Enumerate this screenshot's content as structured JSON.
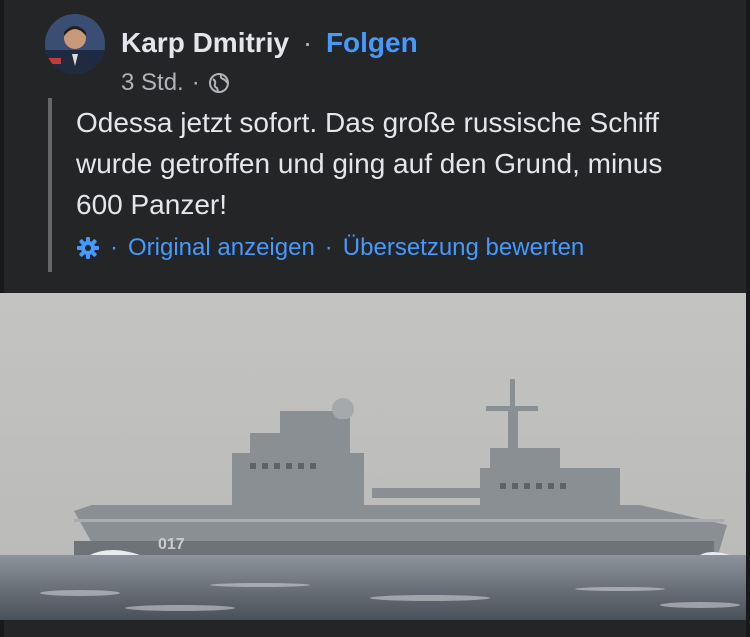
{
  "post": {
    "author": "Karp Dmitriy",
    "separator": "·",
    "follow_label": "Folgen",
    "timestamp": "3 Std.",
    "meta_separator": "·",
    "privacy_icon": "globe-icon",
    "text": "Odessa jetzt sofort. Das große russische Schiff wurde getroffen und ging auf den Grund, minus 600 Panzer!",
    "translation": {
      "settings_icon": "gear-icon",
      "sep1": "·",
      "show_original": "Original anzeigen",
      "sep2": "·",
      "rate_translation": "Übersetzung bewerten"
    },
    "image": {
      "hull_number": "017"
    }
  },
  "colors": {
    "background": "#242526",
    "accent": "#4599ff",
    "text": "#e4e6eb",
    "muted": "#b0b3b8"
  }
}
